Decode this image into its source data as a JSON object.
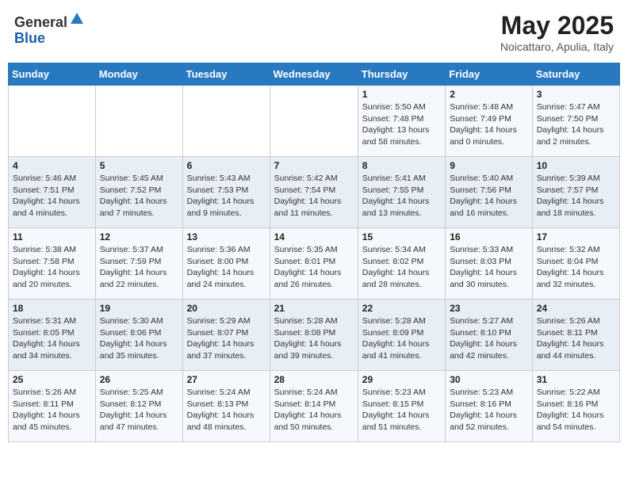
{
  "header": {
    "logo_line1": "General",
    "logo_line2": "Blue",
    "title": "May 2025",
    "subtitle": "Noicattaro, Apulia, Italy"
  },
  "days_of_week": [
    "Sunday",
    "Monday",
    "Tuesday",
    "Wednesday",
    "Thursday",
    "Friday",
    "Saturday"
  ],
  "weeks": [
    [
      {
        "day": "",
        "sunrise": "",
        "sunset": "",
        "daylight": ""
      },
      {
        "day": "",
        "sunrise": "",
        "sunset": "",
        "daylight": ""
      },
      {
        "day": "",
        "sunrise": "",
        "sunset": "",
        "daylight": ""
      },
      {
        "day": "",
        "sunrise": "",
        "sunset": "",
        "daylight": ""
      },
      {
        "day": "1",
        "sunrise": "Sunrise: 5:50 AM",
        "sunset": "Sunset: 7:48 PM",
        "daylight": "Daylight: 13 hours and 58 minutes."
      },
      {
        "day": "2",
        "sunrise": "Sunrise: 5:48 AM",
        "sunset": "Sunset: 7:49 PM",
        "daylight": "Daylight: 14 hours and 0 minutes."
      },
      {
        "day": "3",
        "sunrise": "Sunrise: 5:47 AM",
        "sunset": "Sunset: 7:50 PM",
        "daylight": "Daylight: 14 hours and 2 minutes."
      }
    ],
    [
      {
        "day": "4",
        "sunrise": "Sunrise: 5:46 AM",
        "sunset": "Sunset: 7:51 PM",
        "daylight": "Daylight: 14 hours and 4 minutes."
      },
      {
        "day": "5",
        "sunrise": "Sunrise: 5:45 AM",
        "sunset": "Sunset: 7:52 PM",
        "daylight": "Daylight: 14 hours and 7 minutes."
      },
      {
        "day": "6",
        "sunrise": "Sunrise: 5:43 AM",
        "sunset": "Sunset: 7:53 PM",
        "daylight": "Daylight: 14 hours and 9 minutes."
      },
      {
        "day": "7",
        "sunrise": "Sunrise: 5:42 AM",
        "sunset": "Sunset: 7:54 PM",
        "daylight": "Daylight: 14 hours and 11 minutes."
      },
      {
        "day": "8",
        "sunrise": "Sunrise: 5:41 AM",
        "sunset": "Sunset: 7:55 PM",
        "daylight": "Daylight: 14 hours and 13 minutes."
      },
      {
        "day": "9",
        "sunrise": "Sunrise: 5:40 AM",
        "sunset": "Sunset: 7:56 PM",
        "daylight": "Daylight: 14 hours and 16 minutes."
      },
      {
        "day": "10",
        "sunrise": "Sunrise: 5:39 AM",
        "sunset": "Sunset: 7:57 PM",
        "daylight": "Daylight: 14 hours and 18 minutes."
      }
    ],
    [
      {
        "day": "11",
        "sunrise": "Sunrise: 5:38 AM",
        "sunset": "Sunset: 7:58 PM",
        "daylight": "Daylight: 14 hours and 20 minutes."
      },
      {
        "day": "12",
        "sunrise": "Sunrise: 5:37 AM",
        "sunset": "Sunset: 7:59 PM",
        "daylight": "Daylight: 14 hours and 22 minutes."
      },
      {
        "day": "13",
        "sunrise": "Sunrise: 5:36 AM",
        "sunset": "Sunset: 8:00 PM",
        "daylight": "Daylight: 14 hours and 24 minutes."
      },
      {
        "day": "14",
        "sunrise": "Sunrise: 5:35 AM",
        "sunset": "Sunset: 8:01 PM",
        "daylight": "Daylight: 14 hours and 26 minutes."
      },
      {
        "day": "15",
        "sunrise": "Sunrise: 5:34 AM",
        "sunset": "Sunset: 8:02 PM",
        "daylight": "Daylight: 14 hours and 28 minutes."
      },
      {
        "day": "16",
        "sunrise": "Sunrise: 5:33 AM",
        "sunset": "Sunset: 8:03 PM",
        "daylight": "Daylight: 14 hours and 30 minutes."
      },
      {
        "day": "17",
        "sunrise": "Sunrise: 5:32 AM",
        "sunset": "Sunset: 8:04 PM",
        "daylight": "Daylight: 14 hours and 32 minutes."
      }
    ],
    [
      {
        "day": "18",
        "sunrise": "Sunrise: 5:31 AM",
        "sunset": "Sunset: 8:05 PM",
        "daylight": "Daylight: 14 hours and 34 minutes."
      },
      {
        "day": "19",
        "sunrise": "Sunrise: 5:30 AM",
        "sunset": "Sunset: 8:06 PM",
        "daylight": "Daylight: 14 hours and 35 minutes."
      },
      {
        "day": "20",
        "sunrise": "Sunrise: 5:29 AM",
        "sunset": "Sunset: 8:07 PM",
        "daylight": "Daylight: 14 hours and 37 minutes."
      },
      {
        "day": "21",
        "sunrise": "Sunrise: 5:28 AM",
        "sunset": "Sunset: 8:08 PM",
        "daylight": "Daylight: 14 hours and 39 minutes."
      },
      {
        "day": "22",
        "sunrise": "Sunrise: 5:28 AM",
        "sunset": "Sunset: 8:09 PM",
        "daylight": "Daylight: 14 hours and 41 minutes."
      },
      {
        "day": "23",
        "sunrise": "Sunrise: 5:27 AM",
        "sunset": "Sunset: 8:10 PM",
        "daylight": "Daylight: 14 hours and 42 minutes."
      },
      {
        "day": "24",
        "sunrise": "Sunrise: 5:26 AM",
        "sunset": "Sunset: 8:11 PM",
        "daylight": "Daylight: 14 hours and 44 minutes."
      }
    ],
    [
      {
        "day": "25",
        "sunrise": "Sunrise: 5:26 AM",
        "sunset": "Sunset: 8:11 PM",
        "daylight": "Daylight: 14 hours and 45 minutes."
      },
      {
        "day": "26",
        "sunrise": "Sunrise: 5:25 AM",
        "sunset": "Sunset: 8:12 PM",
        "daylight": "Daylight: 14 hours and 47 minutes."
      },
      {
        "day": "27",
        "sunrise": "Sunrise: 5:24 AM",
        "sunset": "Sunset: 8:13 PM",
        "daylight": "Daylight: 14 hours and 48 minutes."
      },
      {
        "day": "28",
        "sunrise": "Sunrise: 5:24 AM",
        "sunset": "Sunset: 8:14 PM",
        "daylight": "Daylight: 14 hours and 50 minutes."
      },
      {
        "day": "29",
        "sunrise": "Sunrise: 5:23 AM",
        "sunset": "Sunset: 8:15 PM",
        "daylight": "Daylight: 14 hours and 51 minutes."
      },
      {
        "day": "30",
        "sunrise": "Sunrise: 5:23 AM",
        "sunset": "Sunset: 8:16 PM",
        "daylight": "Daylight: 14 hours and 52 minutes."
      },
      {
        "day": "31",
        "sunrise": "Sunrise: 5:22 AM",
        "sunset": "Sunset: 8:16 PM",
        "daylight": "Daylight: 14 hours and 54 minutes."
      }
    ]
  ]
}
